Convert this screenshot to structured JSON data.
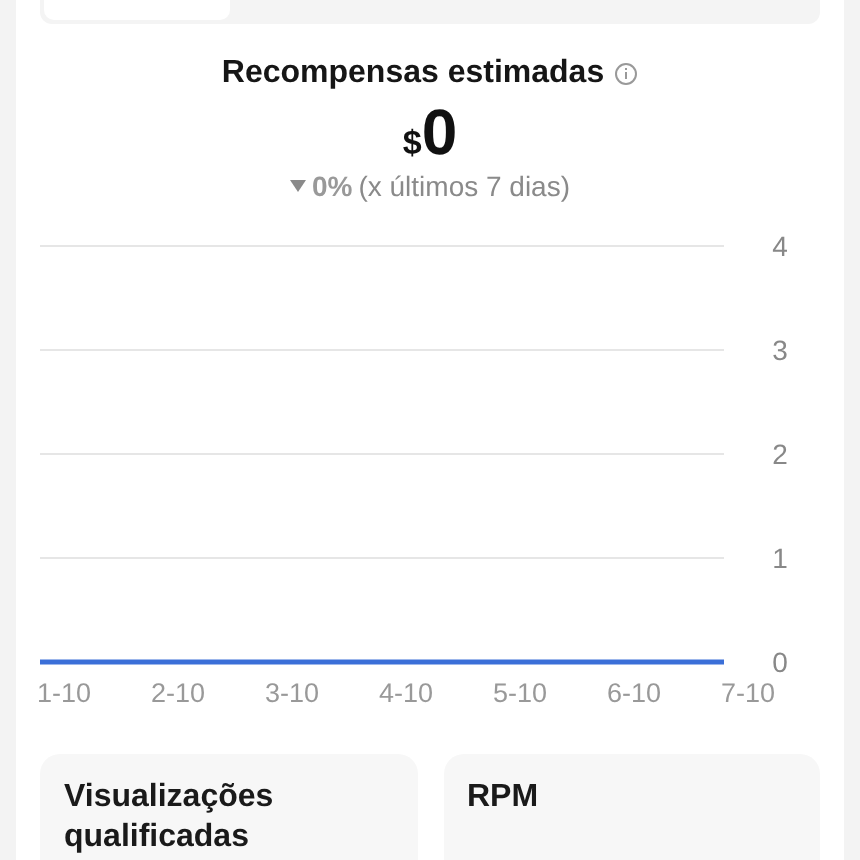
{
  "summary": {
    "title": "Recompensas estimadas",
    "currency": "$",
    "amount": "0",
    "change": "0%",
    "period": "(x últimos 7 dias)"
  },
  "chart_data": {
    "type": "line",
    "categories": [
      "1-10",
      "2-10",
      "3-10",
      "4-10",
      "5-10",
      "6-10",
      "7-10"
    ],
    "series": [
      {
        "color": "#3b6fd8",
        "values": [
          0,
          0,
          0,
          0,
          0,
          0,
          0
        ]
      }
    ],
    "ylim": [
      0,
      4
    ],
    "yticks": [
      0,
      1,
      2,
      3,
      4
    ],
    "grid": true
  },
  "metric_cards": [
    {
      "title": "Visualizações qualificadas"
    },
    {
      "title": "RPM"
    }
  ]
}
